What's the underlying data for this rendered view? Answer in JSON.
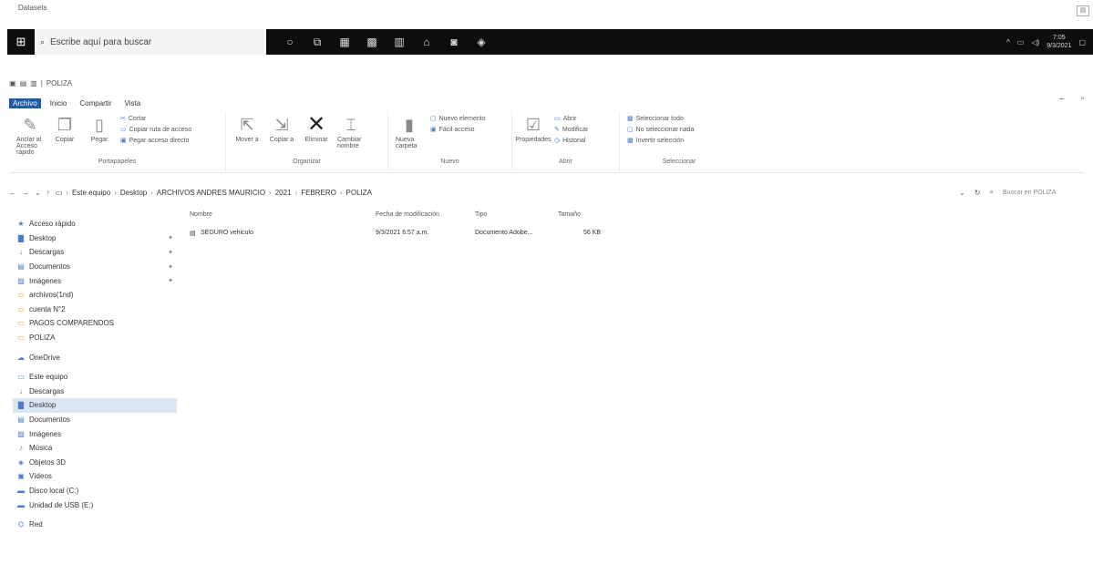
{
  "top_label": "Datasets",
  "taskbar": {
    "search_placeholder": "Escribe aquí para buscar",
    "clock_time": "7:05",
    "clock_date": "9/3/2021"
  },
  "window": {
    "title": "POLIZA"
  },
  "ribbon_tabs": [
    "Archivo",
    "Inicio",
    "Compartir",
    "Vista"
  ],
  "ribbon": {
    "portapapeles": {
      "label": "Portapapeles",
      "anclar": "Anclar al Acceso rápido",
      "copiar": "Copiar",
      "pegar": "Pegar",
      "cortar": "Cortar",
      "copiar_ruta": "Copiar ruta de acceso",
      "pegar_acceso": "Pegar acceso directo"
    },
    "organizar": {
      "label": "Organizar",
      "mover": "Mover a",
      "copiar_a": "Copiar a",
      "eliminar": "Eliminar",
      "cambiar_nombre": "Cambiar nombre"
    },
    "nuevo": {
      "label": "Nuevo",
      "nueva_carpeta": "Nueva carpeta",
      "nuevo_elemento": "Nuevo elemento",
      "facil_acceso": "Fácil acceso"
    },
    "abrir": {
      "label": "Abrir",
      "propiedades": "Propiedades",
      "abrir": "Abrir",
      "modificar": "Modificar",
      "historial": "Historial"
    },
    "seleccionar": {
      "label": "Seleccionar",
      "todo": "Seleccionar todo",
      "nada": "No seleccionar nada",
      "invertir": "Invertir selección"
    }
  },
  "address": {
    "crumbs": [
      "Este equipo",
      "Desktop",
      "ARCHIVOS ANDRES MAURICIO",
      "2021",
      "FEBRERO",
      "POLIZA"
    ],
    "search_placeholder": "Buscar en POLIZA"
  },
  "nav": {
    "quick_access": "Acceso rápido",
    "quick_items": [
      "Desktop",
      "Descargas",
      "Documentos",
      "Imágenes",
      "archivos(1nd)",
      "cuenta N°2",
      "PAGOS COMPARENDOS",
      "POLIZA"
    ],
    "onedrive": "OneDrive",
    "this_pc": "Este equipo",
    "pc_items": [
      "Descargas",
      "Desktop",
      "Documentos",
      "Imágenes",
      "Música",
      "Objetos 3D",
      "Vídeos",
      "Disco local (C:)",
      "Unidad de USB (E:)"
    ],
    "network": "Red"
  },
  "columns": [
    "Nombre",
    "Fecha de modificación",
    "Tipo",
    "Tamaño"
  ],
  "files": [
    {
      "name": "SEGURO vehiculo",
      "date": "9/3/2021 6:57 a.m.",
      "type": "Documento Adobe...",
      "size": "56 KB"
    }
  ]
}
